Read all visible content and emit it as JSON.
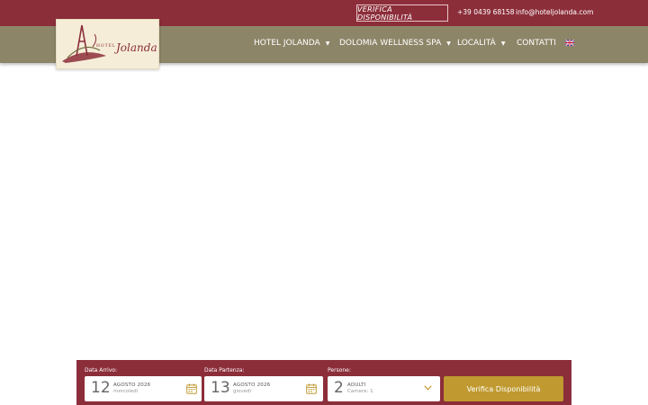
{
  "topbar": {
    "cta_label": "VERIFICA DISPONIBILITÀ",
    "phone": "+39 0439 68158",
    "email": "info@hoteljolanda.com"
  },
  "logo": {
    "hotel": "HOTEL",
    "name": "Jolanda"
  },
  "nav": {
    "items": [
      {
        "label": "HOTEL JOLANDA",
        "has_dropdown": true
      },
      {
        "label": "DOLOMIA WELLNESS SPA",
        "has_dropdown": true
      },
      {
        "label": "LOCALITÀ",
        "has_dropdown": true
      },
      {
        "label": "CONTATTI",
        "has_dropdown": false
      }
    ],
    "language_icon": "uk-flag-icon"
  },
  "booking": {
    "arrival": {
      "label": "Data Arrivo:",
      "day": "12",
      "month": "AGOSTO 2026",
      "weekday": "mercoledì"
    },
    "departure": {
      "label": "Data Partenza:",
      "day": "13",
      "month": "AGOSTO 2026",
      "weekday": "giovedì"
    },
    "guests": {
      "label": "Persone:",
      "count": "2",
      "unit": "ADULTI",
      "rooms": "Camere: 1"
    },
    "submit_label": "Verifica Disponibilità"
  },
  "colors": {
    "brand": "#8c2e3a",
    "nav": "#8d8568",
    "accent": "#c09a30",
    "logo_bg": "#f5edd8"
  }
}
